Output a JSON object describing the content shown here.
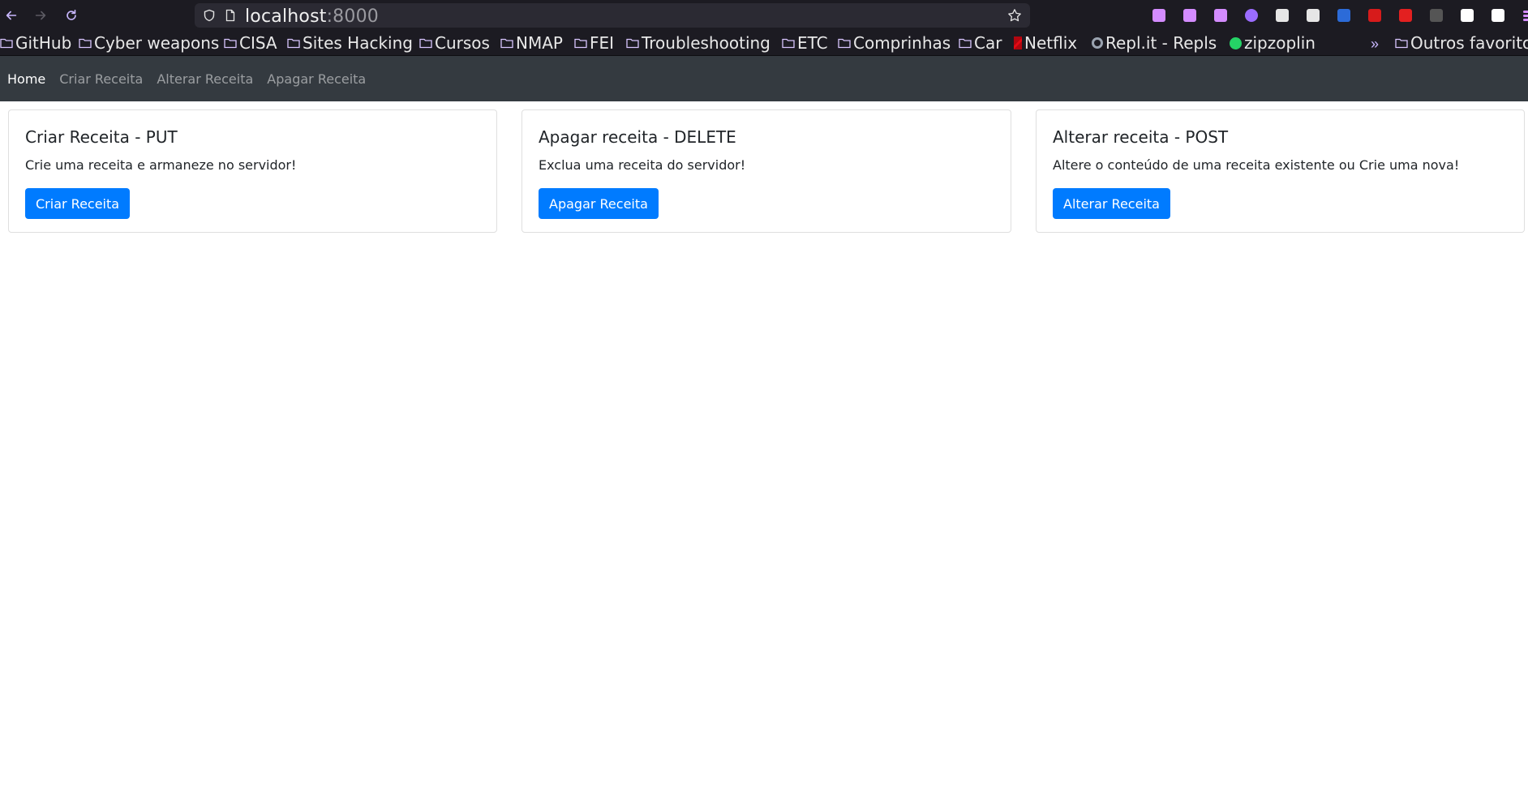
{
  "browser": {
    "url_host": "localhost",
    "url_port": ":8000",
    "back_icon": "arrow-left-icon",
    "forward_icon": "arrow-right-icon",
    "reload_icon": "reload-icon",
    "extensions": [
      {
        "name": "pocket-icon",
        "color": "#d48cff"
      },
      {
        "name": "library-icon",
        "color": "#d48cff"
      },
      {
        "name": "sidebar-icon",
        "color": "#d48cff"
      },
      {
        "name": "joplin-icon",
        "color": "#9b6cff"
      },
      {
        "name": "ghostery-icon",
        "color": "#e6e6e6"
      },
      {
        "name": "privacy-icon",
        "color": "#e6e6e6"
      },
      {
        "name": "bitwarden-icon",
        "color": "#2c6bd8"
      },
      {
        "name": "wappalyzer-icon",
        "color": "#d71b1b"
      },
      {
        "name": "youtube-icon",
        "color": "#e32020"
      },
      {
        "name": "hat-icon",
        "color": "#555555"
      },
      {
        "name": "glasses-icon",
        "color": "#ffffff"
      },
      {
        "name": "bookmark-ext-icon",
        "color": "#ffffff"
      },
      {
        "name": "menu-icon",
        "color": "#d48cff"
      }
    ]
  },
  "bookmarks": [
    {
      "label": "GitHub",
      "type": "folder"
    },
    {
      "label": "Cyber weapons",
      "type": "folder"
    },
    {
      "label": "CISA",
      "type": "folder"
    },
    {
      "label": "Sites Hacking",
      "type": "folder"
    },
    {
      "label": "Cursos",
      "type": "folder"
    },
    {
      "label": "NMAP",
      "type": "folder"
    },
    {
      "label": "FEI",
      "type": "folder"
    },
    {
      "label": "Troubleshooting",
      "type": "folder"
    },
    {
      "label": "ETC",
      "type": "folder"
    },
    {
      "label": "Comprinhas",
      "type": "folder"
    },
    {
      "label": "Car",
      "type": "folder"
    },
    {
      "label": "Netflix",
      "type": "netflix"
    },
    {
      "label": "Repl.it - Repls",
      "type": "replit"
    },
    {
      "label": "zipzoplin",
      "type": "whatsapp"
    }
  ],
  "bookmarks_other": "Outros favorito",
  "nav": {
    "home": "Home",
    "criar": "Criar Receita",
    "alterar": "Alterar Receita",
    "apagar": "Apagar Receita"
  },
  "cards": [
    {
      "title": "Criar Receita - PUT",
      "text": "Crie uma receita e armaneze no servidor!",
      "button": "Criar Receita"
    },
    {
      "title": "Apagar receita - DELETE",
      "text": "Exclua uma receita do servidor!",
      "button": "Apagar Receita"
    },
    {
      "title": "Alterar receita - POST",
      "text": "Altere o conteúdo de uma receita existente ou Crie uma nova!",
      "button": "Alterar Receita"
    }
  ],
  "colors": {
    "primary": "#007bff",
    "navbar": "#343a40",
    "browser_chrome": "#1c1b22"
  }
}
